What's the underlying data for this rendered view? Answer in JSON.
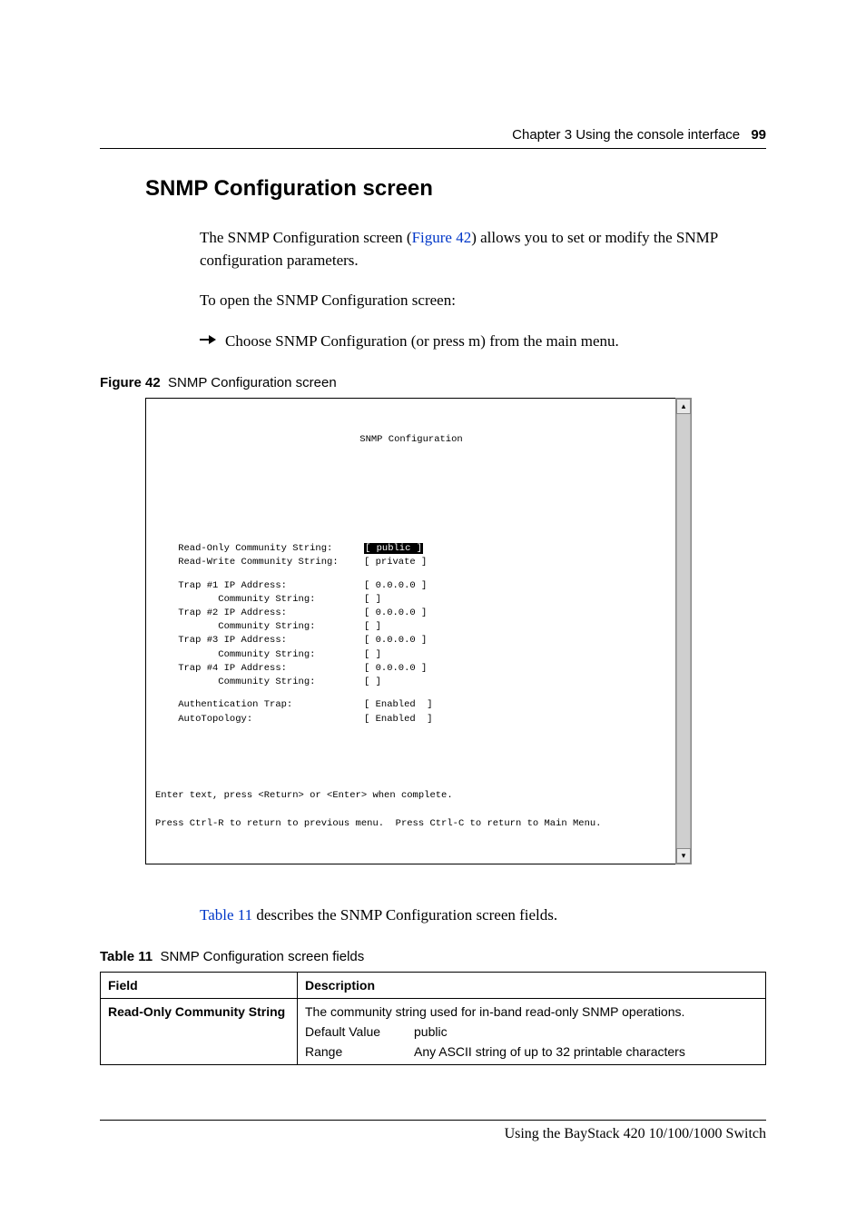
{
  "header": {
    "chapter": "Chapter 3  Using the console interface",
    "page": "99"
  },
  "section_title": "SNMP Configuration screen",
  "para1_a": "The SNMP Configuration screen (",
  "para1_link": "Figure 42",
  "para1_b": ") allows you to set or modify the SNMP configuration parameters.",
  "para2": "To open the SNMP Configuration screen:",
  "bullet": "Choose SNMP Configuration (or press m) from the main menu.",
  "figure_caption": {
    "label": "Figure 42",
    "text": "SNMP Configuration screen"
  },
  "console": {
    "title": "SNMP Configuration",
    "rows": [
      {
        "label": "Read-Only Community String:",
        "value": "[ public ]",
        "highlight": true
      },
      {
        "label": "Read-Write Community String:",
        "value": "[ private ]"
      },
      {
        "spacer": true
      },
      {
        "label": "Trap #1 IP Address:",
        "value": "[ 0.0.0.0 ]"
      },
      {
        "label": "       Community String:",
        "value": "[ ]"
      },
      {
        "label": "Trap #2 IP Address:",
        "value": "[ 0.0.0.0 ]"
      },
      {
        "label": "       Community String:",
        "value": "[ ]"
      },
      {
        "label": "Trap #3 IP Address:",
        "value": "[ 0.0.0.0 ]"
      },
      {
        "label": "       Community String:",
        "value": "[ ]"
      },
      {
        "label": "Trap #4 IP Address:",
        "value": "[ 0.0.0.0 ]"
      },
      {
        "label": "       Community String:",
        "value": "[ ]"
      },
      {
        "spacer": true
      },
      {
        "label": "Authentication Trap:",
        "value": "[ Enabled  ]"
      },
      {
        "label": "AutoTopology:",
        "value": "[ Enabled  ]"
      }
    ],
    "help1": "Enter text, press <Return> or <Enter> when complete.",
    "help2": "Press Ctrl-R to return to previous menu.  Press Ctrl-C to return to Main Menu."
  },
  "para3_link": "Table 11",
  "para3_rest": " describes the SNMP Configuration screen fields.",
  "table_caption": {
    "label": "Table 11",
    "text": "SNMP Configuration screen fields"
  },
  "table": {
    "head": {
      "c1": "Field",
      "c2": "Description"
    },
    "row1": {
      "field": "Read-Only Community String",
      "desc": "The community string used for in-band read-only SNMP operations.",
      "default_k": "Default Value",
      "default_v": "public",
      "range_k": "Range",
      "range_v": "Any ASCII string of up to 32 printable characters"
    }
  },
  "footer": "Using the BayStack 420 10/100/1000 Switch"
}
